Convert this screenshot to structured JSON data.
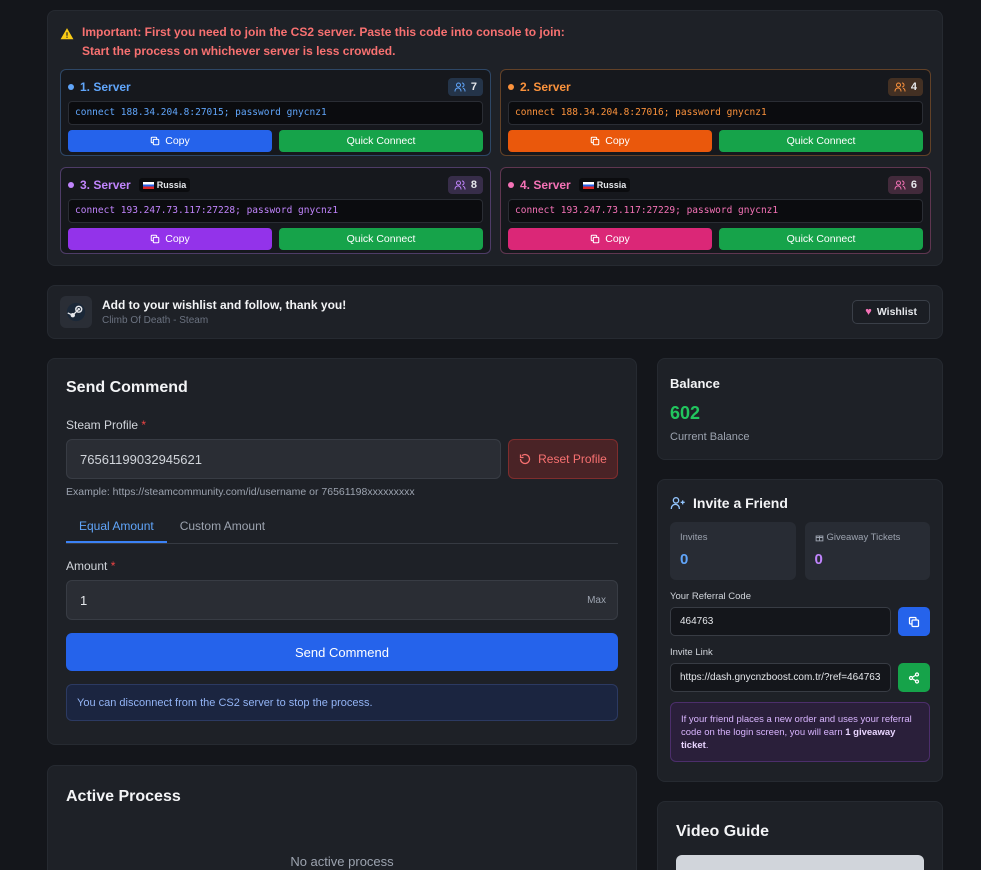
{
  "warning": {
    "line1": "Important: First you need to join the CS2 server. Paste this code into console to join:",
    "line2": "Start the process on whichever server is less crowded."
  },
  "servers": [
    {
      "name": "1. Server",
      "flag": "",
      "count": "7",
      "command": "connect 188.34.204.8:27015; password gnycnz1",
      "copy_label": "Copy",
      "quick_label": "Quick Connect",
      "color": "#60a5fa",
      "btn_color": "#2563eb"
    },
    {
      "name": "2. Server",
      "flag": "",
      "count": "4",
      "command": "connect 188.34.204.8:27016; password gnycnz1",
      "copy_label": "Copy",
      "quick_label": "Quick Connect",
      "color": "#fb923c",
      "btn_color": "#ea580c"
    },
    {
      "name": "3. Server",
      "flag": "Russia",
      "count": "8",
      "command": "connect 193.247.73.117:27228; password gnycnz1",
      "copy_label": "Copy",
      "quick_label": "Quick Connect",
      "color": "#c084fc",
      "btn_color": "#9333ea"
    },
    {
      "name": "4. Server",
      "flag": "Russia",
      "count": "6",
      "command": "connect 193.247.73.117:27229; password gnycnz1",
      "copy_label": "Copy",
      "quick_label": "Quick Connect",
      "color": "#f472b6",
      "btn_color": "#db2777"
    }
  ],
  "wishlist": {
    "title": "Add to your wishlist and follow, thank you!",
    "subtitle": "Climb Of Death - Steam",
    "button": "Wishlist"
  },
  "send": {
    "title": "Send Commend",
    "profile_label": "Steam Profile",
    "required_mark": "*",
    "profile_value": "76561199032945621",
    "reset_label": "Reset Profile",
    "example": "Example: https://steamcommunity.com/id/username or 76561198xxxxxxxxx",
    "tab_equal": "Equal Amount",
    "tab_custom": "Custom Amount",
    "amount_label": "Amount",
    "amount_value": "1",
    "max_label": "Max",
    "submit_label": "Send Commend",
    "info": "You can disconnect from the CS2 server to stop the process."
  },
  "active": {
    "title": "Active Process",
    "empty": "No active process"
  },
  "balance": {
    "title": "Balance",
    "value": "602",
    "caption": "Current Balance"
  },
  "invite": {
    "title": "Invite a Friend",
    "invites_label": "Invites",
    "invites_value": "0",
    "tickets_label": "Giveaway Tickets",
    "tickets_value": "0",
    "code_label": "Your Referral Code",
    "code_value": "464763",
    "link_label": "Invite Link",
    "link_value": "https://dash.gnycnzboost.com.tr/?ref=464763",
    "note_prefix": "If your friend places a new order and uses your referral code on the login screen, you will earn ",
    "note_bold": "1 giveaway ticket",
    "note_suffix": "."
  },
  "video": {
    "title": "Video Guide"
  },
  "colors": {
    "accent": "#2563eb",
    "success": "#16a34a",
    "balance": "#22c55e",
    "warning": "#f87171"
  }
}
